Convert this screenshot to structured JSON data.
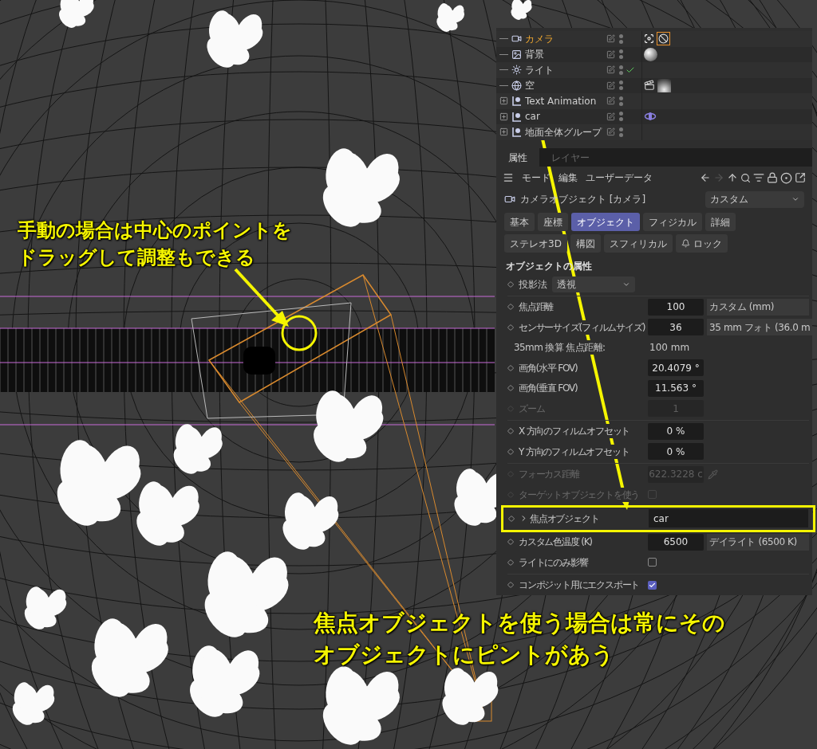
{
  "objects": [
    {
      "name": "カメラ",
      "kind": "camera",
      "expandable": false,
      "selected": true,
      "checked": false,
      "tags": [
        {
          "kind": "target"
        },
        {
          "kind": "ban"
        }
      ]
    },
    {
      "name": "背景",
      "kind": "background",
      "expandable": false,
      "selected": false,
      "checked": false,
      "tags": [
        {
          "kind": "sphere"
        }
      ]
    },
    {
      "name": "ライト",
      "kind": "light",
      "expandable": false,
      "selected": false,
      "checked": true
    },
    {
      "name": "空",
      "kind": "sky",
      "expandable": false,
      "selected": false,
      "checked": false,
      "tags": [
        {
          "kind": "clapper"
        },
        {
          "kind": "sky"
        }
      ]
    },
    {
      "name": "Text Animation",
      "kind": "null",
      "expandable": true,
      "selected": false,
      "checked": false
    },
    {
      "name": "car",
      "kind": "null",
      "expandable": true,
      "selected": false,
      "checked": false,
      "tags": [
        {
          "kind": "orbit"
        }
      ]
    },
    {
      "name": "地面全体グループ",
      "kind": "null",
      "expandable": true,
      "selected": false,
      "checked": false
    }
  ],
  "manager_tabs": [
    {
      "label": "属性",
      "selected": true
    },
    {
      "label": "レイヤー",
      "selected": false
    }
  ],
  "menu": [
    "モード",
    "編集",
    "ユーザーデータ"
  ],
  "object_title": "カメラオブジェクト [カメラ]",
  "preset": "カスタム",
  "pages": [
    {
      "label": "基本",
      "selected": false
    },
    {
      "label": "座標",
      "selected": false
    },
    {
      "label": "オブジェクト",
      "selected": true
    },
    {
      "label": "フィジカル",
      "selected": false
    },
    {
      "label": "詳細",
      "selected": false
    },
    {
      "label": "ステレオ3D",
      "selected": false
    },
    {
      "label": "構図",
      "selected": false
    },
    {
      "label": "スフィリカル",
      "selected": false
    },
    {
      "label": "ロック",
      "selected": false
    }
  ],
  "section_title": "オブジェクトの属性",
  "params": [
    {
      "kind": "dropdown",
      "label": "投影法",
      "value": "透視",
      "disabled": false,
      "divider_before": false
    },
    {
      "kind": "number",
      "label": "焦点距離",
      "value": "100",
      "preset": "カスタム (mm)",
      "disabled": false,
      "divider_before": true
    },
    {
      "kind": "number",
      "label": "センサーサイズ(フィルムサイズ)",
      "value": "36",
      "preset": "35 mm フォト (36.0 m",
      "disabled": false,
      "divider_before": false
    },
    {
      "kind": "info",
      "label": "35mm 換算 焦点距離:",
      "value": "100 mm",
      "disabled": false,
      "divider_before": false
    },
    {
      "kind": "number",
      "label": "画角(水平 FOV)",
      "value": "20.4079 °",
      "disabled": false,
      "divider_before": false
    },
    {
      "kind": "number",
      "label": "画角(垂直 FOV)",
      "value": "11.563 °",
      "disabled": false,
      "divider_before": false
    },
    {
      "kind": "number",
      "label": "ズーム",
      "value": "1",
      "disabled": true,
      "divider_before": false
    },
    {
      "kind": "number",
      "label": "X 方向のフィルムオフセット",
      "value": "0 %",
      "disabled": false,
      "divider_before": true
    },
    {
      "kind": "number",
      "label": "Y 方向のフィルムオフセット",
      "value": "0 %",
      "disabled": false,
      "divider_before": false
    },
    {
      "kind": "picker",
      "label": "フォーカス距離",
      "value": "622.3228 c",
      "disabled": true,
      "divider_before": true
    },
    {
      "kind": "checkbox",
      "label": "ターゲットオブジェクトを使う",
      "checked": false,
      "disabled": true,
      "divider_before": false
    },
    {
      "kind": "link",
      "label": "焦点オブジェクト",
      "value": "car",
      "disabled": false,
      "highlighted": true,
      "divider_before": false
    },
    {
      "kind": "number",
      "label": "カスタム色温度 (K)",
      "value": "6500",
      "preset": "デイライト (6500 K)",
      "disabled": false,
      "divider_before": false
    },
    {
      "kind": "checkbox",
      "label": "ライトにのみ影響",
      "checked": false,
      "disabled": false,
      "divider_before": false
    },
    {
      "kind": "checkbox",
      "label": "コンポジット用にエクスポート",
      "checked": true,
      "disabled": false,
      "divider_before": true
    }
  ],
  "callout_top": {
    "lines": [
      "手動の場合は中心のポイントを",
      "ドラッグして調整もできる"
    ]
  },
  "callout_bottom": {
    "lines": [
      "焦点オブジェクトを使う場合は常にその",
      "オブジェクトにピントがあう"
    ]
  }
}
